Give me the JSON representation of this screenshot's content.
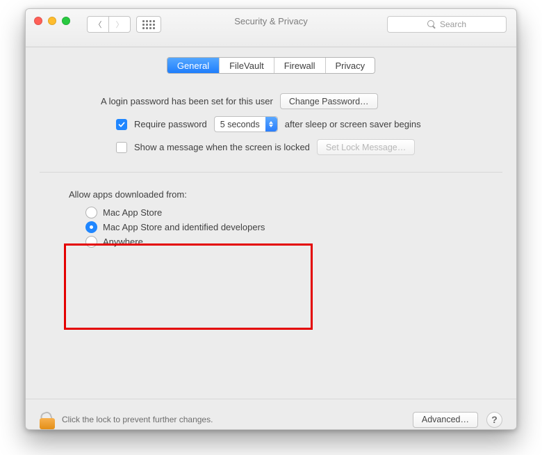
{
  "window": {
    "title": "Security & Privacy",
    "search_placeholder": "Search"
  },
  "tabs": [
    "General",
    "FileVault",
    "Firewall",
    "Privacy"
  ],
  "active_tab": "General",
  "top": {
    "password_set_label": "A login password has been set for this user",
    "change_password_btn": "Change Password…",
    "require_password_label": "Require password",
    "delay_value": "5 seconds",
    "after_sleep_label": "after sleep or screen saver begins",
    "show_message_label": "Show a message when the screen is locked",
    "set_lock_message_btn": "Set Lock Message…",
    "require_password_checked": true,
    "show_message_checked": false
  },
  "allow": {
    "title": "Allow apps downloaded from:",
    "options": [
      "Mac App Store",
      "Mac App Store and identified developers",
      "Anywhere"
    ],
    "selected_index": 1
  },
  "footer": {
    "lock_text": "Click the lock to prevent further changes.",
    "advanced_btn": "Advanced…"
  }
}
